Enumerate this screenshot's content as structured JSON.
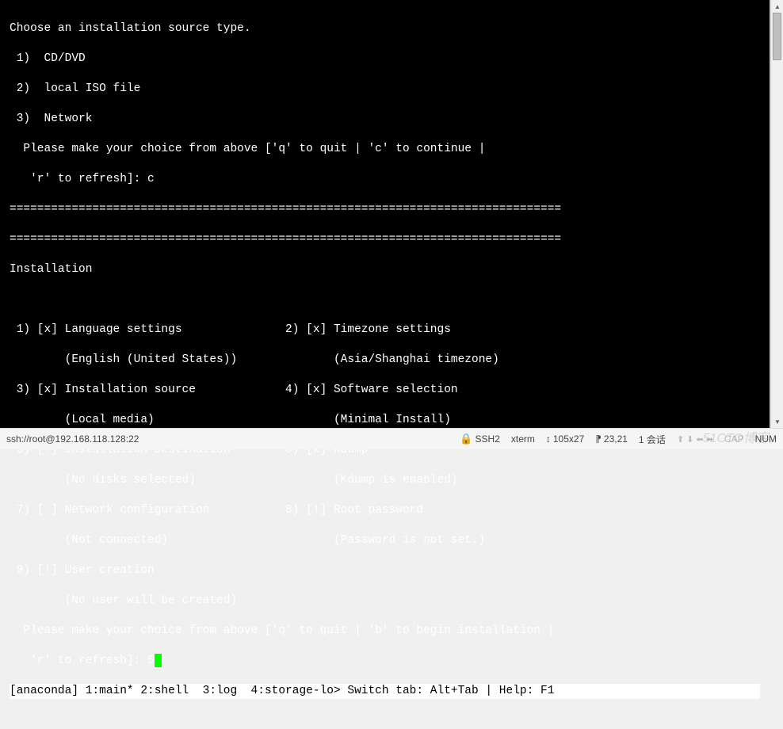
{
  "source_prompt": "Choose an installation source type.",
  "source_options": [
    " 1)  CD/DVD",
    " 2)  local ISO file",
    " 3)  Network"
  ],
  "source_choice_prompt": "  Please make your choice from above ['q' to quit | 'c' to continue |",
  "source_choice_prompt2": "   'r' to refresh]: c",
  "divider": "================================================================================",
  "install_header": "Installation",
  "menu": {
    "r1": " 1) [x] Language settings               2) [x] Timezone settings",
    "r1b": "        (English (United States))              (Asia/Shanghai timezone)",
    "r2": " 3) [x] Installation source             4) [x] Software selection",
    "r2b": "        (Local media)                          (Minimal Install)",
    "r3": " 5) [!] Installation Destination        6) [x] Kdump",
    "r3b": "        (No disks selected)                    (Kdump is enabled)",
    "r4": " 7) [ ] Network configuration           8) [!] Root password",
    "r4b": "        (Not connected)                        (Password is not set.)",
    "r5": " 9) [!] User creation",
    "r5b": "        (No user will be created)"
  },
  "main_prompt": "  Please make your choice from above ['q' to quit | 'b' to begin installation |",
  "main_prompt2": "   'r' to refresh]: 5",
  "tmux_status": "[anaconda] 1:main* 2:shell  3:log  4:storage-lo> Switch tab: Alt+Tab | Help: F1 ",
  "statusbar": {
    "conn": "ssh://root@192.168.118.128:22",
    "proto": "SSH2",
    "term": "xterm",
    "size": "105x27",
    "pos": "23,21",
    "sessions": "1 会话",
    "caps": "CAP",
    "num": "NUM"
  },
  "watermark": "51CTO博客"
}
